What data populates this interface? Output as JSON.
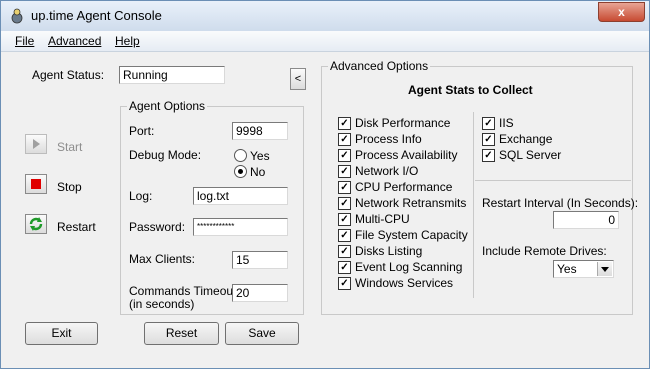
{
  "window": {
    "title": "up.time Agent Console",
    "close_label": "x"
  },
  "menu": [
    "File",
    "Advanced",
    "Help"
  ],
  "status": {
    "label": "Agent Status:",
    "value": "Running"
  },
  "collapse_glyph": "<",
  "controls": {
    "start": "Start",
    "stop": "Stop",
    "restart": "Restart"
  },
  "agent_options": {
    "title": "Agent Options",
    "port_label": "Port:",
    "port": "9998",
    "debug_label": "Debug Mode:",
    "debug_yes": "Yes",
    "debug_no": "No",
    "log_label": "Log:",
    "log": "log.txt",
    "password_label": "Password:",
    "password": "************",
    "max_clients_label": "Max Clients:",
    "max_clients": "15",
    "cmd_timeout_label_1": "Commands Timeout:",
    "cmd_timeout_label_2": "(in seconds)",
    "cmd_timeout": "20"
  },
  "advanced": {
    "title": "Advanced Options",
    "stats_title": "Agent Stats to Collect",
    "stats_left": [
      "Disk Performance",
      "Process Info",
      "Process Availability",
      "Network I/O",
      "CPU Performance",
      "Network Retransmits",
      "Multi-CPU",
      "File System Capacity",
      "Disks Listing",
      "Event Log Scanning",
      "Windows Services"
    ],
    "stats_right": [
      "IIS",
      "Exchange",
      "SQL Server"
    ],
    "restart_label": "Restart Interval (In Seconds):",
    "restart_value": "0",
    "remote_label": "Include Remote Drives:",
    "remote_value": "Yes"
  },
  "buttons": {
    "exit": "Exit",
    "reset": "Reset",
    "save": "Save"
  }
}
